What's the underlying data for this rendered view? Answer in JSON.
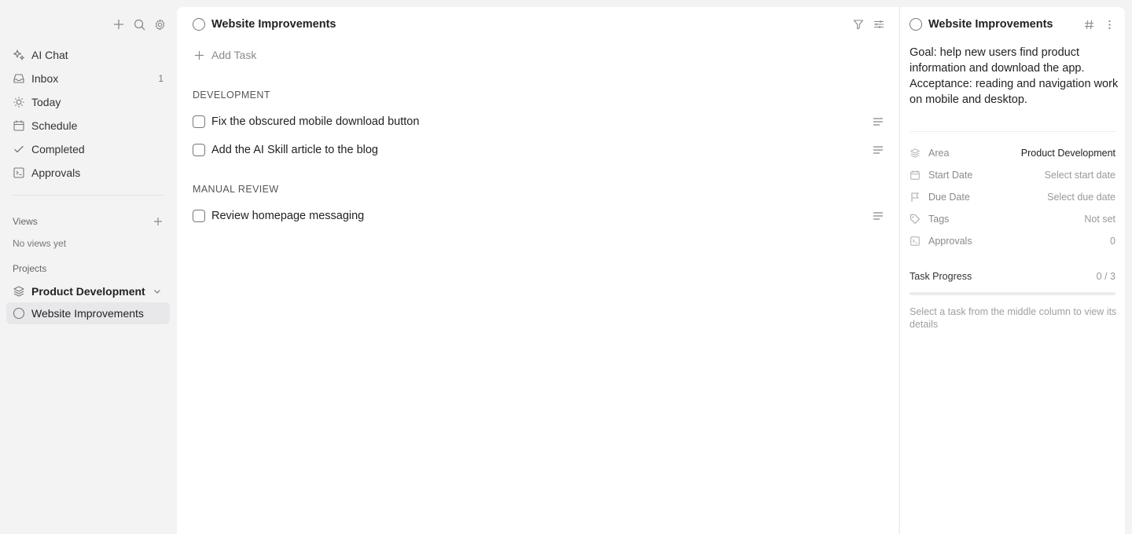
{
  "sidebar": {
    "nav": [
      {
        "label": "AI Chat",
        "count": ""
      },
      {
        "label": "Inbox",
        "count": "1"
      },
      {
        "label": "Today",
        "count": ""
      },
      {
        "label": "Schedule",
        "count": ""
      },
      {
        "label": "Completed",
        "count": ""
      },
      {
        "label": "Approvals",
        "count": ""
      }
    ],
    "views_label": "Views",
    "no_views": "No views yet",
    "projects_label": "Projects",
    "area_name": "Product Development",
    "project_name": "Website Improvements"
  },
  "main": {
    "title": "Website Improvements",
    "add_task": "Add Task",
    "groups": [
      {
        "title": "DEVELOPMENT",
        "tasks": [
          "Fix the obscured mobile download button",
          "Add the AI Skill article to the blog"
        ]
      },
      {
        "title": "MANUAL REVIEW",
        "tasks": [
          "Review homepage messaging"
        ]
      }
    ]
  },
  "details": {
    "title": "Website Improvements",
    "description": "Goal: help new users find product information and download the app. Acceptance: reading and navigation work on mobile and desktop.",
    "props": {
      "area": {
        "label": "Area",
        "value": "Product Development"
      },
      "start": {
        "label": "Start Date",
        "value": "Select start date"
      },
      "due": {
        "label": "Due Date",
        "value": "Select due date"
      },
      "tags": {
        "label": "Tags",
        "value": "Not set"
      },
      "approvals": {
        "label": "Approvals",
        "value": "0"
      }
    },
    "progress_label": "Task Progress",
    "progress_value": "0 / 3",
    "progress_fraction": 0,
    "hint": "Select a task from the middle column to view its details"
  }
}
